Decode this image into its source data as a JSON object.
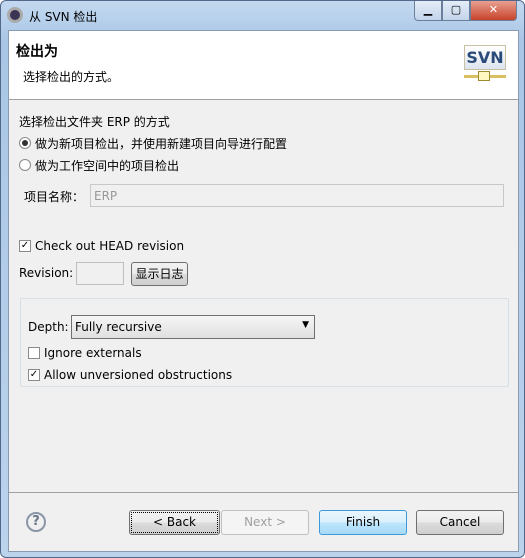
{
  "window": {
    "title": "从 SVN 检出",
    "minimize": "▁",
    "maximize": "▢",
    "close": "✕"
  },
  "header": {
    "title": "检出为",
    "subtitle": "选择检出的方式。",
    "logo_text": "SVN"
  },
  "main": {
    "prompt": "选择检出文件夹 ERP 的方式",
    "radio_new_project": {
      "label": "做为新项目检出，并使用新建项目向导进行配置",
      "checked": true
    },
    "radio_workspace": {
      "label": "做为工作空间中的项目检出",
      "checked": false
    },
    "project_name_label": "项目名称：",
    "project_name_value": "ERP",
    "head_revision": {
      "label": "Check out HEAD revision",
      "checked": true
    },
    "revision_label": "Revision:",
    "revision_value": "",
    "show_log": "显示日志",
    "depth_label": "Depth:",
    "depth_value": "Fully recursive",
    "ignore_externals": {
      "label": "Ignore externals",
      "checked": false
    },
    "allow_unversioned": {
      "label": "Allow unversioned obstructions",
      "checked": true
    }
  },
  "footer": {
    "back": "< Back",
    "next": "Next >",
    "finish": "Finish",
    "cancel": "Cancel",
    "help": "?"
  }
}
